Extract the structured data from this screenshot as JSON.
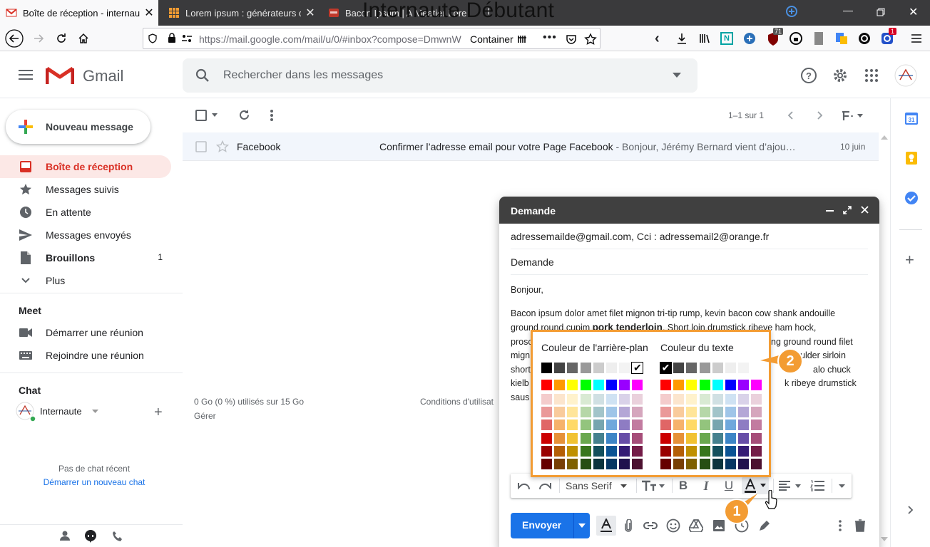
{
  "browser": {
    "tabs": [
      {
        "label": "Boîte de réception - internaute",
        "close": "✕"
      },
      {
        "label": "Lorem ipsum : générateurs de f",
        "close": "✕"
      },
      {
        "label": "Bacon Ipsum | A Meatier Lore",
        "close": "✕"
      }
    ],
    "overlay_title": "Internaute Débutant",
    "url": "https://mail.google.com/mail/u/0/#inbox?compose=DmwnW",
    "container_label": "Container",
    "badges": {
      "ublock": "71",
      "notif": "1"
    }
  },
  "gmail": {
    "logo_text": "Gmail",
    "search_placeholder": "Rechercher dans les messages",
    "compose_label": "Nouveau message",
    "nav": [
      {
        "label": "Boîte de réception",
        "icon": "inbox-icon"
      },
      {
        "label": "Messages suivis",
        "icon": "star-icon"
      },
      {
        "label": "En attente",
        "icon": "clock-icon"
      },
      {
        "label": "Messages envoyés",
        "icon": "send-icon"
      },
      {
        "label": "Brouillons",
        "icon": "draft-icon",
        "count": "1"
      },
      {
        "label": "Plus",
        "icon": "chevron-down-icon"
      }
    ],
    "meet": {
      "title": "Meet",
      "items": [
        "Démarrer une réunion",
        "Rejoindre une réunion"
      ]
    },
    "chat": {
      "title": "Chat",
      "user": "Internaute",
      "empty": "Pas de chat récent",
      "start_link": "Démarrer un nouveau chat"
    },
    "pagination": "1–1 sur 1",
    "mail": {
      "sender": "Facebook",
      "subject": "Confirmer l’adresse email pour votre Page Facebook",
      "snippet": " - Bonjour, Jérémy Bernard vient d’ajou…",
      "date": "10 juin"
    },
    "storage": "0 Go (0 %) utilisés sur 15 Go",
    "manage": "Gérer",
    "terms": "Conditions d'utilisat"
  },
  "compose": {
    "title": "Demande",
    "recipients": "adressemailde@gmail.com, Cci : adressemail2@orange.fr",
    "subject": "Demande",
    "greeting": "Bonjour,",
    "body_lines": [
      "Bacon ipsum dolor amet filet mignon tri-tip rump, kevin bacon cow shank andouille",
      "ground round cupim",
      "pork tenderloin",
      ". Short loin drumstick ribeye ham hock,",
      "prosc",
      "ng ground round filet",
      "mign",
      "ulder sirloin",
      "short",
      "alo chuck",
      "kielb",
      "k ribeye drumstick",
      "saus"
    ],
    "font_name": "Sans Serif",
    "send_label": "Envoyer"
  },
  "palette": {
    "bg_title": "Couleur de l'arrière-plan",
    "text_title": "Couleur du texte",
    "grays": [
      "#000000",
      "#444444",
      "#666666",
      "#999999",
      "#cccccc",
      "#eeeeee",
      "#f3f3f3",
      "#ffffff"
    ],
    "brights": [
      "#ff0000",
      "#ff9900",
      "#ffff00",
      "#00ff00",
      "#00ffff",
      "#0000ff",
      "#9900ff",
      "#ff00ff"
    ],
    "rows": [
      [
        "#f4cccc",
        "#fce5cd",
        "#fff2cc",
        "#d9ead3",
        "#d0e0e3",
        "#cfe2f3",
        "#d9d2e9",
        "#ead1dc"
      ],
      [
        "#ea9999",
        "#f9cb9c",
        "#ffe599",
        "#b6d7a8",
        "#a2c4c9",
        "#9fc5e8",
        "#b4a7d6",
        "#d5a6bd"
      ],
      [
        "#e06666",
        "#f6b26b",
        "#ffd966",
        "#93c47d",
        "#76a5af",
        "#6fa8dc",
        "#8e7cc3",
        "#c27ba0"
      ],
      [
        "#cc0000",
        "#e69138",
        "#f1c232",
        "#6aa84f",
        "#45818e",
        "#3d85c6",
        "#674ea7",
        "#a64d79"
      ],
      [
        "#990000",
        "#b45f06",
        "#bf9000",
        "#38761d",
        "#134f5c",
        "#0b5394",
        "#351c75",
        "#741b47"
      ],
      [
        "#660000",
        "#783f04",
        "#7f6000",
        "#274e13",
        "#0c343d",
        "#073763",
        "#20124d",
        "#4c1130"
      ]
    ],
    "bg_selected": "#ffffff",
    "text_selected": "#000000"
  },
  "callouts": [
    "1",
    "2"
  ],
  "colors": {
    "accent": "#f39c33",
    "gmail_red": "#d93025",
    "send_blue": "#1a73e8"
  }
}
